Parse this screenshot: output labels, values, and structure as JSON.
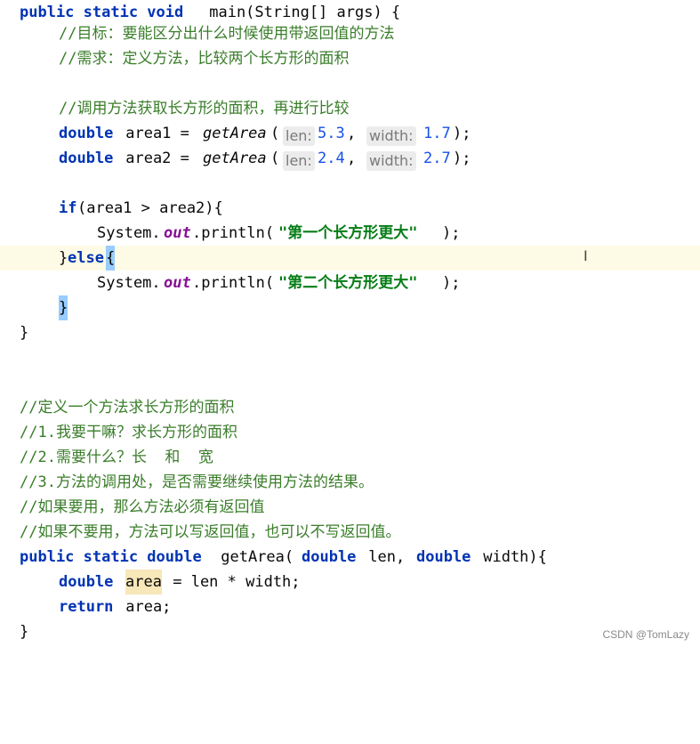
{
  "code": {
    "l1_kw": "public static void",
    "l1_rest": " main(String[] args) {",
    "l2_comment": "//目标：要能区分出什么时候使用带返回值的方法",
    "l3_comment": "//需求：定义方法，比较两个长方形的面积",
    "l5_comment": "//调用方法获取长方形的面积，再进行比较",
    "l6_kw": "double",
    "l6_var": " area1 = ",
    "l6_call": "getArea",
    "l6_hint1": "len:",
    "l6_v1": "5.3",
    "l6_hint2": "width:",
    "l6_v2": "1.7",
    "l7_kw": "double",
    "l7_var": " area2 = ",
    "l7_call": "getArea",
    "l7_hint1": "len:",
    "l7_v1": "2.4",
    "l7_hint2": "width:",
    "l7_v2": "2.7",
    "l9_kw": "if",
    "l9_rest": "(area1 > area2){",
    "l10_sys": "System.",
    "l10_out": "out",
    "l10_print": ".println(",
    "l10_str": "\"第一个长方形更大\"",
    "l10_end": ");",
    "l11_close": "}",
    "l11_else": "else",
    "l11_brace": "{",
    "l12_sys": "System.",
    "l12_out": "out",
    "l12_print": ".println(",
    "l12_str": "\"第二个长方形更大\"",
    "l12_end": ");",
    "l13_brace": "}",
    "l14_brace": "}",
    "c1": "//定义一个方法求长方形的面积",
    "c2": "//1.我要干嘛？求长方形的面积",
    "c3": "//2.需要什么？长  和  宽",
    "c4": "//3.方法的调用处，是否需要继续使用方法的结果。",
    "c5": "//如果要用，那么方法必须有返回值",
    "c6": "//如果不要用，方法可以写返回值，也可以不写返回值。",
    "m1_kw": "public static double",
    "m1_name": " getArea(",
    "m1_kw2": "double",
    "m1_len": " len, ",
    "m1_kw3": "double",
    "m1_width": " width){",
    "m2_kw": "double",
    "m2_area": "area",
    "m2_rest": " = len * width;",
    "m3_kw": "return",
    "m3_rest": " area;",
    "m4_brace": "}"
  },
  "watermark": "CSDN @TomLazy",
  "colors": {
    "keyword": "#0033b3",
    "comment": "#3a7d2a",
    "number": "#1750eb",
    "string": "#067d17",
    "field": "#871094",
    "current_line": "#fdfbe6"
  }
}
